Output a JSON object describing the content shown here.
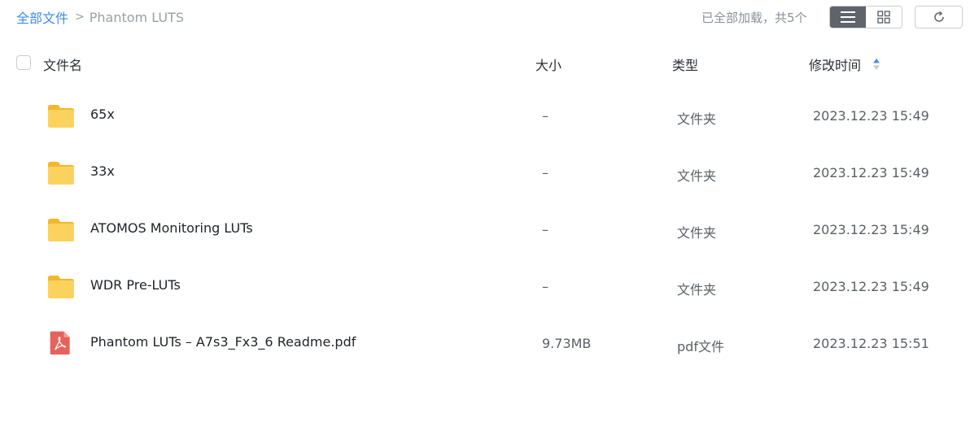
{
  "breadcrumb": {
    "root": "全部文件",
    "separator": ">",
    "current": "Phantom LUTS"
  },
  "toolbar": {
    "status": "已全部加载，共5个",
    "view_list_icon": "list-view-icon",
    "view_grid_icon": "grid-view-icon",
    "refresh_icon": "refresh-icon"
  },
  "columns": {
    "name": "文件名",
    "size": "大小",
    "type": "类型",
    "modified": "修改时间"
  },
  "files": [
    {
      "name": "65x",
      "size": "–",
      "type": "文件夹",
      "modified": "2023.12.23 15:49",
      "icon": "folder-icon"
    },
    {
      "name": "33x",
      "size": "–",
      "type": "文件夹",
      "modified": "2023.12.23 15:49",
      "icon": "folder-icon"
    },
    {
      "name": "ATOMOS Monitoring LUTs",
      "size": "–",
      "type": "文件夹",
      "modified": "2023.12.23 15:49",
      "icon": "folder-icon"
    },
    {
      "name": "WDR Pre-LUTs",
      "size": "–",
      "type": "文件夹",
      "modified": "2023.12.23 15:49",
      "icon": "folder-icon"
    },
    {
      "name": "Phantom LUTs – A7s3_Fx3_6 Readme.pdf",
      "size": "9.73MB",
      "type": "pdf文件",
      "modified": "2023.12.23 15:51",
      "icon": "pdf-icon"
    }
  ],
  "colors": {
    "accent": "#3b8cf0",
    "folder": "#f8c542",
    "pdf": "#e8625c",
    "active_toggle": "#5f646b"
  }
}
